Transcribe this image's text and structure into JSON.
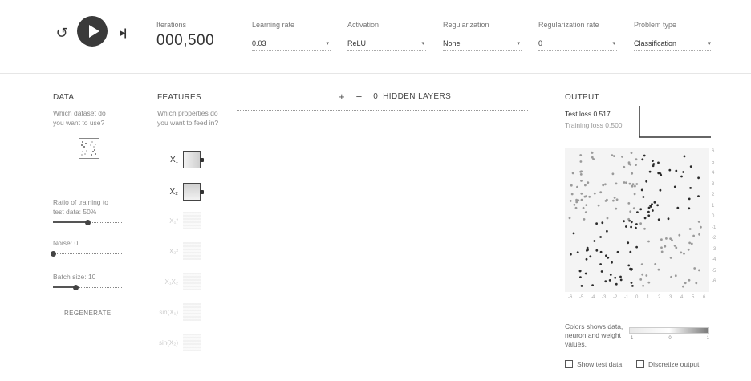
{
  "controls": {
    "reset_glyph": "↺",
    "step_glyph": "▸|"
  },
  "topbar": {
    "iterations": {
      "label": "Iterations",
      "value": "000,500"
    },
    "learning_rate": {
      "label": "Learning rate",
      "value": "0.03"
    },
    "activation": {
      "label": "Activation",
      "value": "ReLU"
    },
    "regularization": {
      "label": "Regularization",
      "value": "None"
    },
    "regularization_rate": {
      "label": "Regularization rate",
      "value": "0"
    },
    "problem_type": {
      "label": "Problem type",
      "value": "Classification"
    }
  },
  "data_panel": {
    "title": "DATA",
    "description": "Which dataset do you want to use?",
    "ratio": {
      "label": "Ratio of training to test data:",
      "value": "50%",
      "fraction": 0.5
    },
    "noise": {
      "label": "Noise:",
      "value": "0",
      "fraction": 0.0
    },
    "batch": {
      "label": "Batch size:",
      "value": "10",
      "fraction": 0.33
    },
    "regenerate_label": "REGENERATE"
  },
  "features_panel": {
    "title": "FEATURES",
    "description": "Which properties do you want to feed in?",
    "features": [
      {
        "label": "X₁",
        "active": true
      },
      {
        "label": "X₂",
        "active": true
      },
      {
        "label": "X₁²",
        "active": false
      },
      {
        "label": "X₂²",
        "active": false
      },
      {
        "label": "X₁X₂",
        "active": false
      },
      {
        "label": "sin(X₁)",
        "active": false
      },
      {
        "label": "sin(X₂)",
        "active": false
      }
    ]
  },
  "network": {
    "plus_glyph": "+",
    "minus_glyph": "−",
    "hidden_layers_count": "0",
    "hidden_layers_label": "HIDDEN LAYERS"
  },
  "output_panel": {
    "title": "OUTPUT",
    "test_loss_label": "Test loss",
    "test_loss_value": "0.517",
    "training_loss_label": "Training loss",
    "training_loss_value": "0.500",
    "axis_ticks": [
      "-6",
      "-5",
      "-4",
      "-3",
      "-2",
      "-1",
      "0",
      "1",
      "2",
      "3",
      "4",
      "5",
      "6"
    ],
    "legend_text": "Colors shows data, neuron and weight values.",
    "legend_ticks": [
      "-1",
      "0",
      "1"
    ],
    "show_test_data_label": "Show test data",
    "discretize_output_label": "Discretize output"
  },
  "colors": {
    "positive_point": "#2b2b2b",
    "negative_point": "#9a9a9a",
    "plot_background": "#f4f4f4"
  }
}
